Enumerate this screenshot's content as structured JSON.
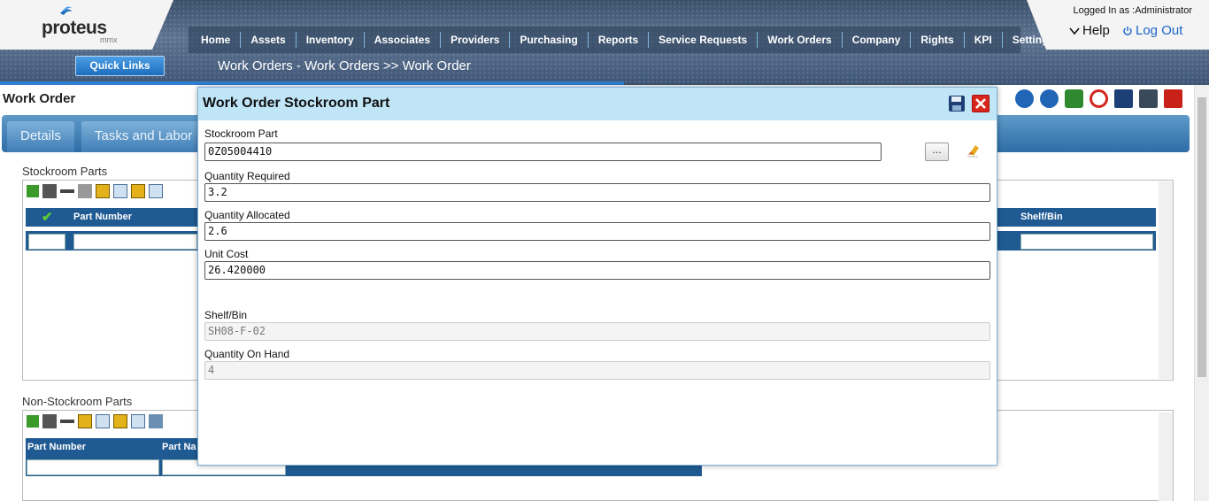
{
  "header": {
    "logo_name": "proteus",
    "logo_sub": "mmx",
    "quick_links": "Quick Links",
    "nav": [
      "Home",
      "Assets",
      "Inventory",
      "Associates",
      "Providers",
      "Purchasing",
      "Reports",
      "Service Requests",
      "Work Orders",
      "Company",
      "Rights",
      "KPI",
      "Settings"
    ],
    "breadcrumb": "Work Orders - Work Orders >> Work Order",
    "logged_in": "Logged In as :Administrator",
    "help": "Help",
    "logout": "Log Out"
  },
  "page": {
    "title": "Work Order",
    "tabs": [
      "Details",
      "Tasks and Labor"
    ],
    "stockroom_section": "Stockroom Parts",
    "stockroom_columns": [
      "Part Number",
      "Shelf/Bin"
    ],
    "nonstock_section": "Non-Stockroom Parts",
    "nonstock_columns": [
      "Part Number",
      "Part Na"
    ]
  },
  "modal": {
    "title": "Work Order Stockroom Part",
    "browse_label": "...",
    "fields": {
      "stockroom_part": {
        "label": "Stockroom Part",
        "value": "0Z05004410"
      },
      "quantity_required": {
        "label": "Quantity Required",
        "value": "3.2"
      },
      "quantity_allocated": {
        "label": "Quantity Allocated",
        "value": "2.6"
      },
      "unit_cost": {
        "label": "Unit Cost",
        "value": "26.420000"
      },
      "shelf_bin": {
        "label": "Shelf/Bin",
        "value": "SH08-F-02"
      },
      "quantity_on_hand": {
        "label": "Quantity On Hand",
        "value": "4"
      }
    }
  },
  "colors": {
    "brand_blue": "#2f7fd2",
    "grid_header": "#1f5a92",
    "modal_header": "#bfe5f7",
    "close_red": "#d9261c"
  }
}
